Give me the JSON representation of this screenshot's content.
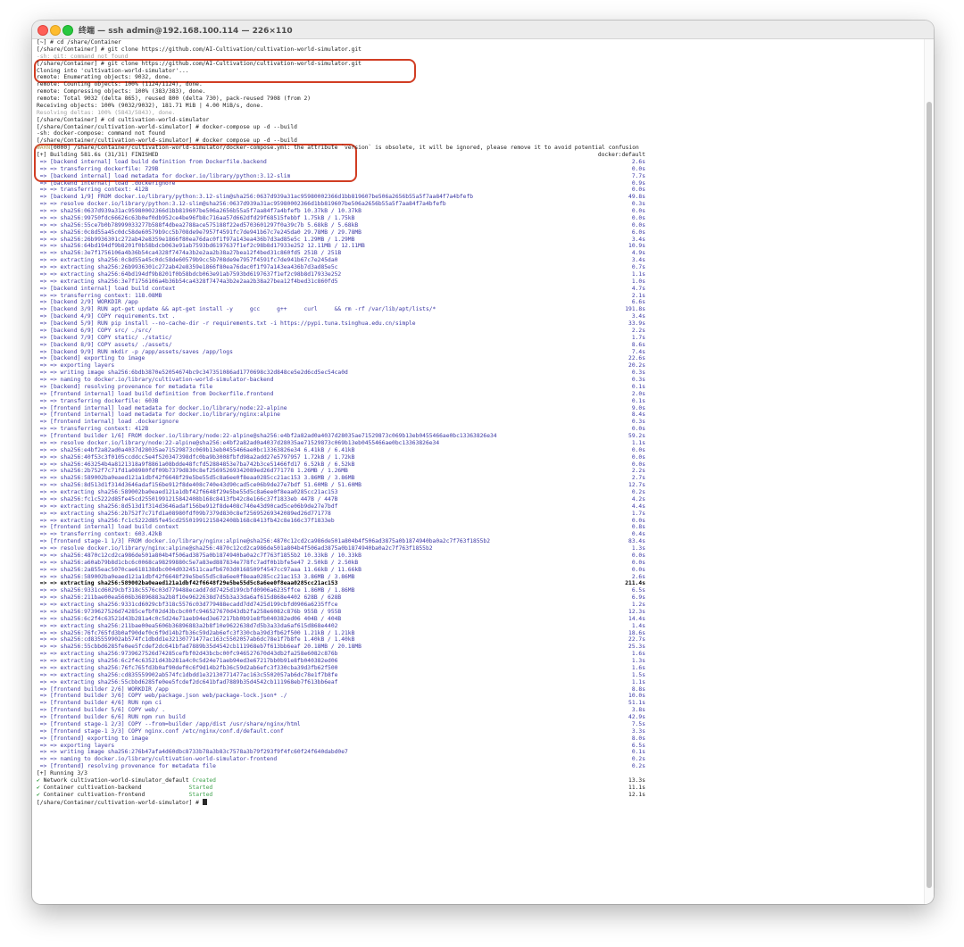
{
  "window": {
    "title": "终端 — ssh admin@192.168.100.114 — 226×110"
  },
  "icons": [
    "close-icon",
    "minimize-icon",
    "zoom-icon"
  ],
  "colors": {
    "highlight": "#d13d23",
    "blue": "#3a37a3",
    "green": "#3fa24c"
  },
  "terminal": {
    "prompt": "[/share/Container/cultivation-world-simulator] # ",
    "lines": [
      {
        "t": "[~] # cd /share/Container",
        "k": "p"
      },
      {
        "t": "[/share/Container] # git clone https://github.com/AI-Cultivation/cultivation-world-simulator.git",
        "k": "p"
      },
      {
        "t": "-sh: git: command not found",
        "k": "p"
      },
      {
        "t": "[/share/Container] # git clone https://github.com/AI-Cultivation/cultivation-world-simulator.git",
        "k": "p"
      },
      {
        "t": "Cloning into 'cultivation-world-simulator'...",
        "k": "p"
      },
      {
        "t": "remote: Enumerating objects: 9032, done.",
        "k": "p"
      },
      {
        "t": "remote: Counting objects: 100% (1124/1124), done.",
        "k": "p"
      },
      {
        "t": "remote: Compressing objects: 100% (383/383), done.",
        "k": "p"
      },
      {
        "t": "remote: Total 9032 (delta 865), reused 800 (delta 730), pack-reused 7908 (from 2)",
        "k": "p"
      },
      {
        "t": "Receiving objects: 100% (9032/9032), 181.71 MiB | 4.00 MiB/s, done.",
        "k": "p"
      },
      {
        "t": "Resolving deltas: 100% (5843/5843), done.",
        "k": "p"
      },
      {
        "t": "[/share/Container] # cd cultivation-world-simulator",
        "k": "p"
      },
      {
        "t": "[/share/Container/cultivation-world-simulator] # docker-compose up -d --build",
        "k": "p"
      },
      {
        "t": "-sh: docker-compose: command not found",
        "k": "p"
      },
      {
        "t": "[/share/Container/cultivation-world-simulator] # docker compose up -d --build",
        "k": "p"
      },
      {
        "w": "WARN",
        "t": "[0000] /share/Container/cultivation-world-simulator/docker-compose.yml: the attribute `version` is obsolete, it will be ignored, please remove it to avoid potential confusion",
        "k": "p"
      },
      {
        "t": "[+] Building 581.6s (31/31) FINISHED",
        "d": "docker:default",
        "k": "h"
      },
      {
        "t": " => [backend internal] load build definition from Dockerfile.backend",
        "d": "2.6s",
        "k": "b"
      },
      {
        "t": " => => transferring dockerfile: 729B",
        "d": "0.0s",
        "k": "b"
      },
      {
        "t": " => [backend internal] load metadata for docker.io/library/python:3.12-slim",
        "d": "7.7s",
        "k": "b"
      },
      {
        "t": " => [backend internal] load .dockerignore",
        "d": "0.9s",
        "k": "b"
      },
      {
        "t": " => => transferring context: 412B",
        "d": "0.0s",
        "k": "b"
      },
      {
        "t": " => [backend 1/9] FROM docker.io/library/python:3.12-slim@sha256:0637d939a31ac95980002366d1bb819607be506a2656b55a5f7aa84f7a4bfefb",
        "d": "49.8s",
        "k": "b"
      },
      {
        "t": " => => resolve docker.io/library/python:3.12-slim@sha256:0637d939a31ac95980002366d1bb819607be506a2656b55a5f7aa84f7a4bfefb",
        "d": "0.3s",
        "k": "b"
      },
      {
        "t": " => => sha256:0637d939a31ac95980002366d1bb819607be506a2656b55a5f7aa84f7a4bfefb 10.37kB / 10.37kB",
        "d": "0.0s",
        "k": "b"
      },
      {
        "t": " => => sha256:99750fdc66626c63b0ef0db952ce4be96fb8c716aa57d662dfd29f68515febbf 1.75kB / 1.75kB",
        "d": "0.0s",
        "k": "b"
      },
      {
        "t": " => => sha256:55ce7b0b78999033277b588f4dbea2788ace575188f22ed5703601297f0a39c7b 5.68kB / 5.68kB",
        "d": "0.0s",
        "k": "b"
      },
      {
        "t": " => => sha256:0c8d55a45c0dc58de60579b9cc5b708de9e7957f4591fc7de941b67c7e245da0 29.78MB / 29.78MB",
        "d": "6.0s",
        "k": "b"
      },
      {
        "t": " => => sha256:26b9936301c272ab42e8359e1866f80ea76dac0f1f97a143ea436b7d3ad85e5c 1.29MB / 1.29MB",
        "d": "3.4s",
        "k": "b"
      },
      {
        "t": " => => sha256:64bd194df9b8201f0b58bdcb063e91ab7593bd6197637f1ef2c98b8d17933e252 12.11MB / 12.11MB",
        "d": "10.9s",
        "k": "b"
      },
      {
        "t": " => => sha256:3e7f1756106a4b36b54ca4328f7474a3b2e2aa2b38a27bea12f4bed31c860fd5 251B / 251B",
        "d": "4.9s",
        "k": "b"
      },
      {
        "t": " => => extracting sha256:0c8d55a45c0dc58de60579b9cc5b708de9e7957f4591fc7de941b67c7e245da0",
        "d": "3.4s",
        "k": "b"
      },
      {
        "t": " => => extracting sha256:26b9936301c272ab42e8359e1866f80ea76dac0f1f97a143ea436b7d3ad85e5c",
        "d": "0.7s",
        "k": "b"
      },
      {
        "t": " => => extracting sha256:64bd194df9b8201f0b58bdcb063e91ab7593bd6197637f1ef2c98b8d17933e252",
        "d": "1.1s",
        "k": "b"
      },
      {
        "t": " => => extracting sha256:3e7f1756106a4b36b54ca4328f7474a3b2e2aa2b38a27bea12f4bed31c860fd5",
        "d": "1.0s",
        "k": "b"
      },
      {
        "t": " => [backend internal] load build context",
        "d": "4.7s",
        "k": "b"
      },
      {
        "t": " => => transferring context: 118.08MB",
        "d": "2.1s",
        "k": "b"
      },
      {
        "t": " => [backend 2/9] WORKDIR /app",
        "d": "6.6s",
        "k": "b"
      },
      {
        "t": " => [backend 3/9] RUN apt-get update && apt-get install -y     gcc     g++     curl     && rm -rf /var/lib/apt/lists/*",
        "d": "191.8s",
        "k": "b"
      },
      {
        "t": " => [backend 4/9] COPY requirements.txt .",
        "d": "3.4s",
        "k": "b"
      },
      {
        "t": " => [backend 5/9] RUN pip install --no-cache-dir -r requirements.txt -i https://pypi.tuna.tsinghua.edu.cn/simple",
        "d": "33.9s",
        "k": "b"
      },
      {
        "t": " => [backend 6/9] COPY src/ ./src/",
        "d": "2.2s",
        "k": "b"
      },
      {
        "t": " => [backend 7/9] COPY static/ ./static/",
        "d": "1.7s",
        "k": "b"
      },
      {
        "t": " => [backend 8/9] COPY assets/ ./assets/",
        "d": "8.6s",
        "k": "b"
      },
      {
        "t": " => [backend 9/9] RUN mkdir -p /app/assets/saves /app/logs",
        "d": "7.4s",
        "k": "b"
      },
      {
        "t": " => [backend] exporting to image",
        "d": "22.6s",
        "k": "b"
      },
      {
        "t": " => => exporting layers",
        "d": "20.2s",
        "k": "b"
      },
      {
        "t": " => => writing image sha256:6bdb3870e52054674bc9c347351086ad1770698c32d848ce5e2d6cd5ec54ca0d",
        "d": "0.3s",
        "k": "b"
      },
      {
        "t": " => => naming to docker.io/library/cultivation-world-simulator-backend",
        "d": "0.3s",
        "k": "b"
      },
      {
        "t": " => [backend] resolving provenance for metadata file",
        "d": "0.1s",
        "k": "b"
      },
      {
        "t": " => [frontend internal] load build definition from Dockerfile.frontend",
        "d": "2.0s",
        "k": "b"
      },
      {
        "t": " => => transferring dockerfile: 603B",
        "d": "0.1s",
        "k": "b"
      },
      {
        "t": " => [frontend internal] load metadata for docker.io/library/node:22-alpine",
        "d": "9.0s",
        "k": "b"
      },
      {
        "t": " => [frontend internal] load metadata for docker.io/library/nginx:alpine",
        "d": "8.4s",
        "k": "b"
      },
      {
        "t": " => [frontend internal] load .dockerignore",
        "d": "0.3s",
        "k": "b"
      },
      {
        "t": " => => transferring context: 412B",
        "d": "0.0s",
        "k": "b"
      },
      {
        "t": " => [frontend builder 1/6] FROM docker.io/library/node:22-alpine@sha256:e4bf2a82ad0a4037d28035ae71529873c069b13eb0455466ae0bc13363826e34",
        "d": "59.2s",
        "k": "b"
      },
      {
        "t": " => => resolve docker.io/library/node:22-alpine@sha256:e4bf2a82ad0a4037d28035ae71529873c069b13eb0455466ae0bc13363826e34",
        "d": "1.1s",
        "k": "b"
      },
      {
        "t": " => => sha256:e4bf2a82ad0a4037d28035ae71529873c069b13eb0455466ae0bc13363826e34 6.41kB / 6.41kB",
        "d": "0.0s",
        "k": "b"
      },
      {
        "t": " => => sha256:40f53c3f0105ccddcc5e4f520347398dfc0ba9b3008fbfd98a2add27e5797957 1.72kB / 1.72kB",
        "d": "0.0s",
        "k": "b"
      },
      {
        "t": " => => sha256:463254b4a8121318a9f8861a08bdde48fcfd52884853e7ba742b3ce51466fd17 6.52kB / 6.52kB",
        "d": "0.0s",
        "k": "b"
      },
      {
        "t": " => => sha256:2b752f7c71fd1a08980fdf09b7379d830c8ef25695269342089ed26d771778 1.26MB / 1.26MB",
        "d": "2.2s",
        "k": "b"
      },
      {
        "t": " => => sha256:589002ba0eaed121a1dbf42f6648f29e5be55d5c8a6ee0f8eaa0285cc21ac153 3.86MB / 3.86MB",
        "d": "2.7s",
        "k": "b"
      },
      {
        "t": " => => sha256:8d513d1f314d3646adaf156be912f8de408c740e43d90cad5ce06b9de27e7bdf 51.60MB / 51.60MB",
        "d": "12.7s",
        "k": "b"
      },
      {
        "t": " => => extracting sha256:589002ba0eaed121a1dbf42f6648f29e5be55d5c8a6ee0f8eaa0285cc21ac153",
        "d": "0.2s",
        "k": "b"
      },
      {
        "t": " => => sha256:fc1c5222d85fe45cd25501991215842408b168c8413fb42c8e166c37f1833eb 447B / 447B",
        "d": "4.2s",
        "k": "b"
      },
      {
        "t": " => => extracting sha256:8d513d1f314d3646adaf156be912f8de408c740e43d90cad5ce06b9de27e7bdf",
        "d": "4.4s",
        "k": "b"
      },
      {
        "t": " => => extracting sha256:2b752f7c71fd1a08980fdf09b7379d830c8ef25695269342089ed26d771778",
        "d": "1.7s",
        "k": "b"
      },
      {
        "t": " => => extracting sha256:fc1c5222d85fe45cd25501991215842408b168c8413fb42c8e166c37f1833eb",
        "d": "0.0s",
        "k": "b"
      },
      {
        "t": " => [frontend internal] load build context",
        "d": "0.8s",
        "k": "b"
      },
      {
        "t": " => => transferring context: 603.42kB",
        "d": "0.4s",
        "k": "b"
      },
      {
        "t": " => [frontend stage-1 1/3] FROM docker.io/library/nginx:alpine@sha256:4870c12cd2ca986de501a804b4f506ad3875a0b1874940ba0a2c7f763f1855b2",
        "d": "83.4s",
        "k": "b"
      },
      {
        "t": " => => resolve docker.io/library/nginx:alpine@sha256:4870c12cd2ca986de501a804b4f506ad3875a0b1874940ba0a2c7f763f1855b2",
        "d": "1.3s",
        "k": "b"
      },
      {
        "t": " => => sha256:4870c12cd2ca986de501a804b4f506ad3875a0b1874940ba0a2c7f763f1855b2 10.33kB / 10.33kB",
        "d": "0.0s",
        "k": "b"
      },
      {
        "t": " => => sha256:a60ab79b8d1cbc6c0068ca98299880c5e7a83ed887834e778fc7adf0b1bfe5e47 2.50kB / 2.50kB",
        "d": "0.0s",
        "k": "b"
      },
      {
        "t": " => => sha256:2a855eac5070cae618138dbc004d0324511caafb6703d0168509f4547cc97aaa 11.66kB / 11.66kB",
        "d": "0.0s",
        "k": "b"
      },
      {
        "t": " => => sha256:589002ba0eaed121a1dbf42f6648f29e5be55d5c8a6ee0f8eaa0285cc21ac153 3.86MB / 3.86MB",
        "d": "2.6s",
        "k": "b"
      },
      {
        "t": " => => extracting sha256:589002ba0eaed121a1dbf42f6648f29e5be55d5c8a6ee0f8eaa0285cc21ac153",
        "d": "211.4s",
        "k": "bold"
      },
      {
        "t": " => => sha256:9331cd6029cbf318c5576c03d779488ecadd7dd7425d199cbfd0906a6235ffce 1.86MB / 1.86MB",
        "d": "6.5s",
        "k": "b"
      },
      {
        "t": " => => sha256:211bae00ea5606b36896883a2b8f10e9622638d7d5b3a33da6af615d868e4402 628B / 628B",
        "d": "6.9s",
        "k": "b"
      },
      {
        "t": " => => extracting sha256:9331cd6029cbf318c5576c03d779488ecadd7dd7425d199cbfd0906a6235ffce",
        "d": "1.2s",
        "k": "b"
      },
      {
        "t": " => => sha256:9739627526d74285cefbf02d43bcbc00fc946527670d43db2fa258e6082c876b 955B / 955B",
        "d": "12.3s",
        "k": "b"
      },
      {
        "t": " => => sha256:6c2f4c63521d43b281a4c0c5d24e71aeb94ed3e67217bb0b91e8fb040382ed06 404B / 404B",
        "d": "14.4s",
        "k": "b"
      },
      {
        "t": " => => extracting sha256:211bae00ea5606b36896883a2b8f10e9622638d7d5b3a33da6af615d868e4402",
        "d": "1.4s",
        "k": "b"
      },
      {
        "t": " => => sha256:76fc765fd3b0af90def0c6f9d14b2fb36c59d2ab6efc3f330cba39d3fb62f500 1.21kB / 1.21kB",
        "d": "18.6s",
        "k": "b"
      },
      {
        "t": " => => sha256:cd835559902ab574fc1dbdd1e32130771477ac163c5502057ab6dc78e1f7b8fe 1.40kB / 1.40kB",
        "d": "22.7s",
        "k": "b"
      },
      {
        "t": " => => sha256:55cbbd6285fe0ee5fcdef2dc641bfad7889b35d4542cb111968eb7f613bb6eaf 20.18MB / 20.18MB",
        "d": "25.3s",
        "k": "b"
      },
      {
        "t": " => => extracting sha256:9739627526d74285cefbf02d43bcbc00fc946527670d43db2fa258e6082c876b",
        "d": "1.6s",
        "k": "b"
      },
      {
        "t": " => => extracting sha256:6c2f4c63521d43b281a4c0c5d24e71aeb94ed3e67217bb0b91e8fb040382ed06",
        "d": "1.3s",
        "k": "b"
      },
      {
        "t": " => => extracting sha256:76fc765fd3b0af90def0c6f9d14b2fb36c59d2ab6efc3f330cba39d3fb62f500",
        "d": "1.6s",
        "k": "b"
      },
      {
        "t": " => => extracting sha256:cd835559902ab574fc1dbdd1e32130771477ac163c5502057ab6dc78e1f7b8fe",
        "d": "1.5s",
        "k": "b"
      },
      {
        "t": " => => extracting sha256:55cbbd6285fe0ee5fcdef2dc641bfad7889b35d4542cb111968eb7f613bb6eaf",
        "d": "1.1s",
        "k": "b"
      },
      {
        "t": " => [frontend builder 2/6] WORKDIR /app",
        "d": "8.8s",
        "k": "b"
      },
      {
        "t": " => [frontend builder 3/6] COPY web/package.json web/package-lock.json* ./",
        "d": "10.0s",
        "k": "b"
      },
      {
        "t": " => [frontend builder 4/6] RUN npm ci",
        "d": "51.1s",
        "k": "b"
      },
      {
        "t": " => [frontend builder 5/6] COPY web/ .",
        "d": "3.8s",
        "k": "b"
      },
      {
        "t": " => [frontend builder 6/6] RUN npm run build",
        "d": "42.9s",
        "k": "b"
      },
      {
        "t": " => [frontend stage-1 2/3] COPY --from=builder /app/dist /usr/share/nginx/html",
        "d": "7.5s",
        "k": "b"
      },
      {
        "t": " => [frontend stage-1 3/3] COPY nginx.conf /etc/nginx/conf.d/default.conf",
        "d": "3.3s",
        "k": "b"
      },
      {
        "t": " => [frontend] exporting to image",
        "d": "8.0s",
        "k": "b"
      },
      {
        "t": " => => exporting layers",
        "d": "6.5s",
        "k": "b"
      },
      {
        "t": " => => writing image sha256:276b47afa4d60dbc8733b78a3b83c7578a3b79f293f9f4fc60f24f640dabd0e7",
        "d": "0.1s",
        "k": "b"
      },
      {
        "t": " => => naming to docker.io/library/cultivation-world-simulator-frontend",
        "d": "0.2s",
        "k": "b"
      },
      {
        "t": " => [frontend] resolving provenance for metadata file",
        "d": "0.2s",
        "k": "b"
      },
      {
        "t": "[+] Running 3/3",
        "k": "p"
      },
      {
        "check": "✔",
        "t": "Network cultivation-world-simulator_default ",
        "s": "Created",
        "d": "13.3s",
        "k": "r"
      },
      {
        "check": "✔",
        "t": "Container cultivation-backend              ",
        "s": "Started",
        "d": "11.1s",
        "k": "r"
      },
      {
        "check": "✔",
        "t": "Container cultivation-frontend             ",
        "s": "Started",
        "d": "12.1s",
        "k": "r"
      }
    ]
  }
}
